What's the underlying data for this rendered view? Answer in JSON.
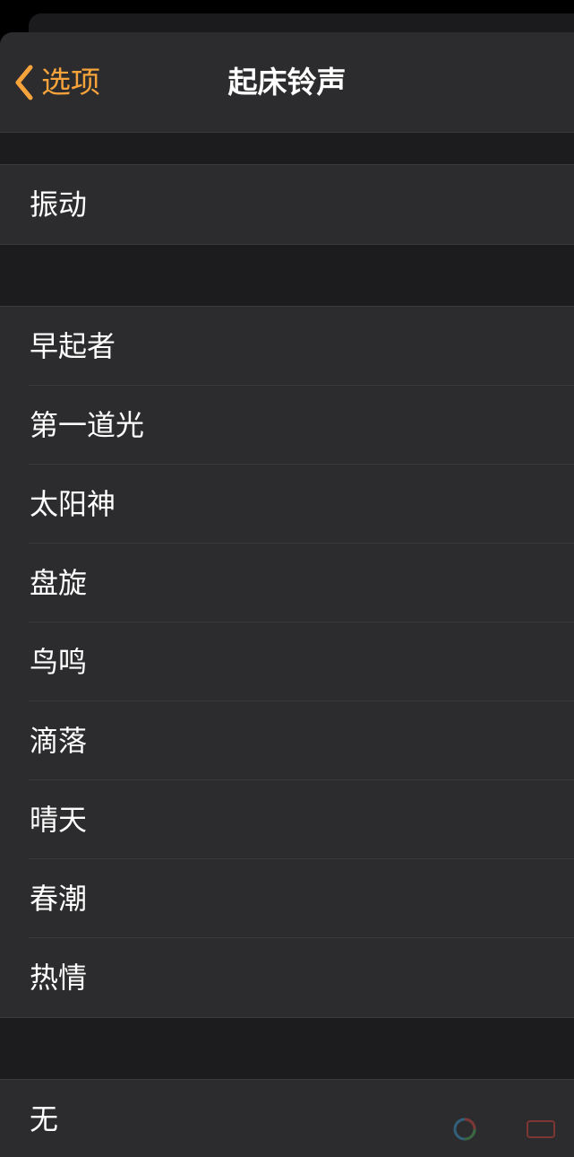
{
  "nav": {
    "back_label": "选项",
    "title": "起床铃声"
  },
  "vibration": {
    "label": "振动"
  },
  "tones": [
    {
      "label": "早起者"
    },
    {
      "label": "第一道光"
    },
    {
      "label": "太阳神"
    },
    {
      "label": "盘旋"
    },
    {
      "label": "鸟鸣"
    },
    {
      "label": "滴落"
    },
    {
      "label": "晴天"
    },
    {
      "label": "春潮"
    },
    {
      "label": "热情"
    }
  ],
  "none_option": {
    "label": "无"
  },
  "colors": {
    "accent": "#f7a33c",
    "background": "#1c1c1e",
    "cell": "#2c2c2e"
  },
  "icons": {
    "back": "chevron-left-icon"
  }
}
